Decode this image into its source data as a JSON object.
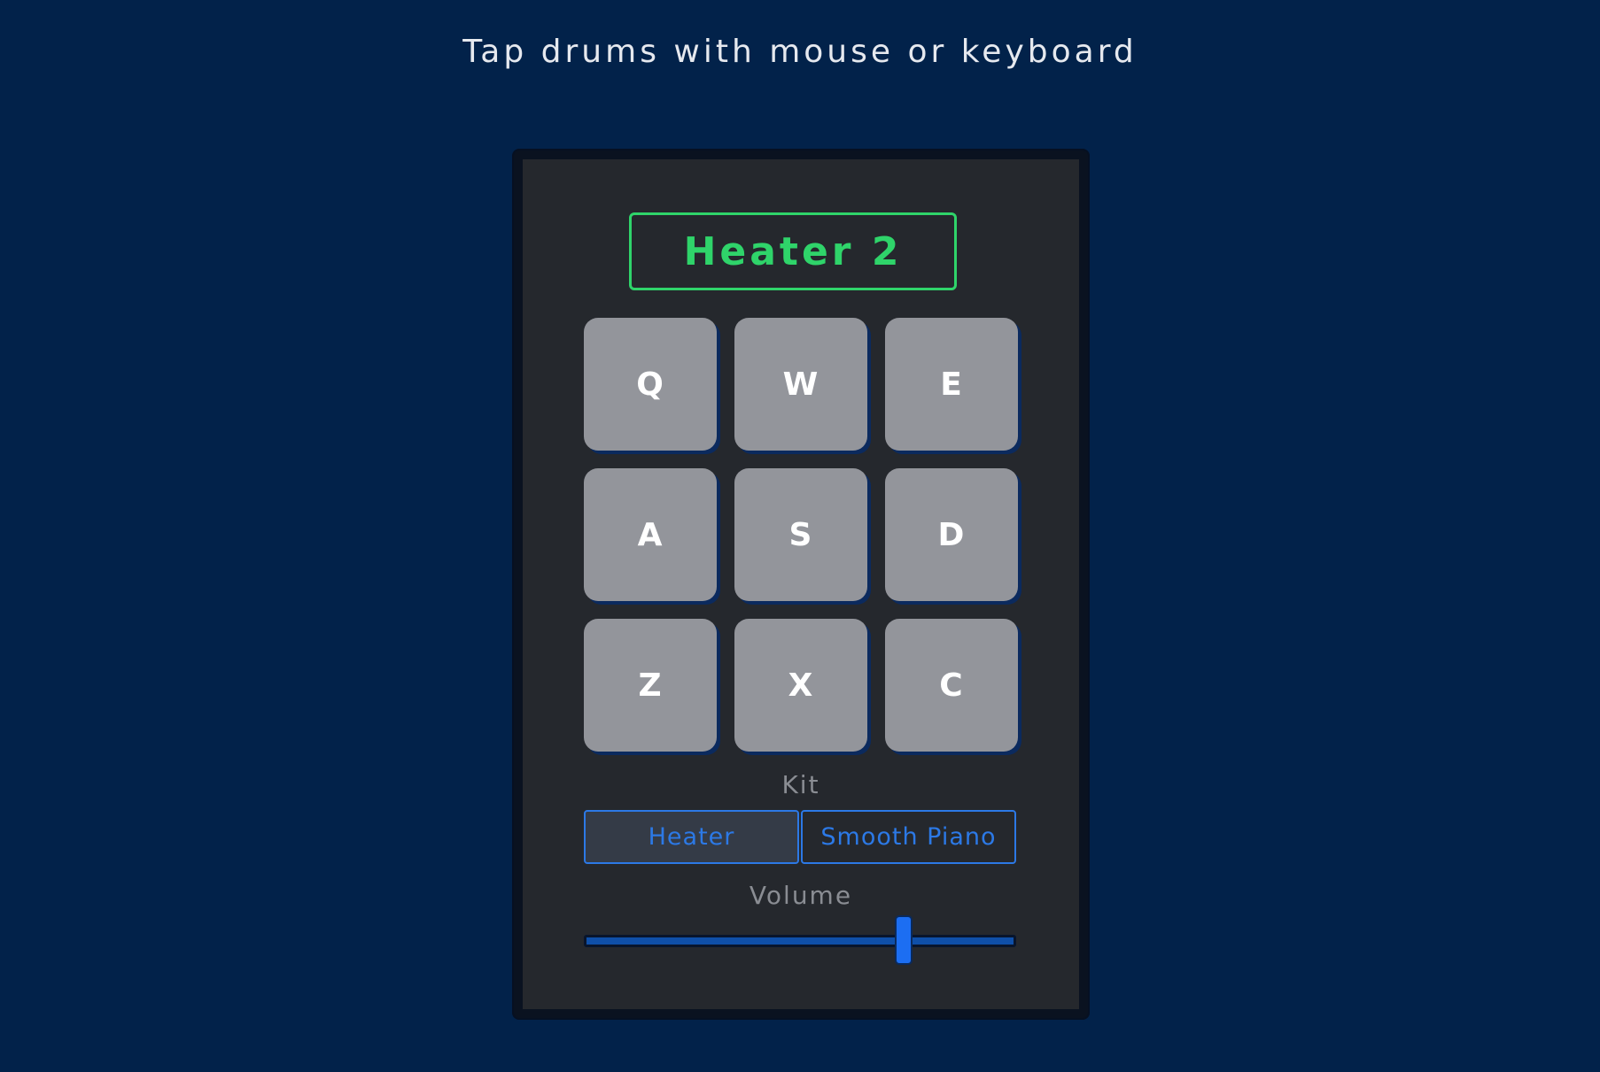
{
  "header": {
    "instructions": "Tap drums with mouse or keyboard"
  },
  "display": {
    "text": "Heater 2"
  },
  "pads": [
    {
      "key": "Q"
    },
    {
      "key": "W"
    },
    {
      "key": "E"
    },
    {
      "key": "A"
    },
    {
      "key": "S"
    },
    {
      "key": "D"
    },
    {
      "key": "Z"
    },
    {
      "key": "X"
    },
    {
      "key": "C"
    }
  ],
  "kit": {
    "label": "Kit",
    "options": [
      "Heater",
      "Smooth Piano"
    ],
    "selected": "Heater"
  },
  "volume": {
    "label": "Volume",
    "value": 0.74
  },
  "colors": {
    "background": "#02224a",
    "panel": "#25282d",
    "display_accent": "#2fd46a",
    "pad": "#93959b",
    "accent_blue": "#2c79e6"
  }
}
